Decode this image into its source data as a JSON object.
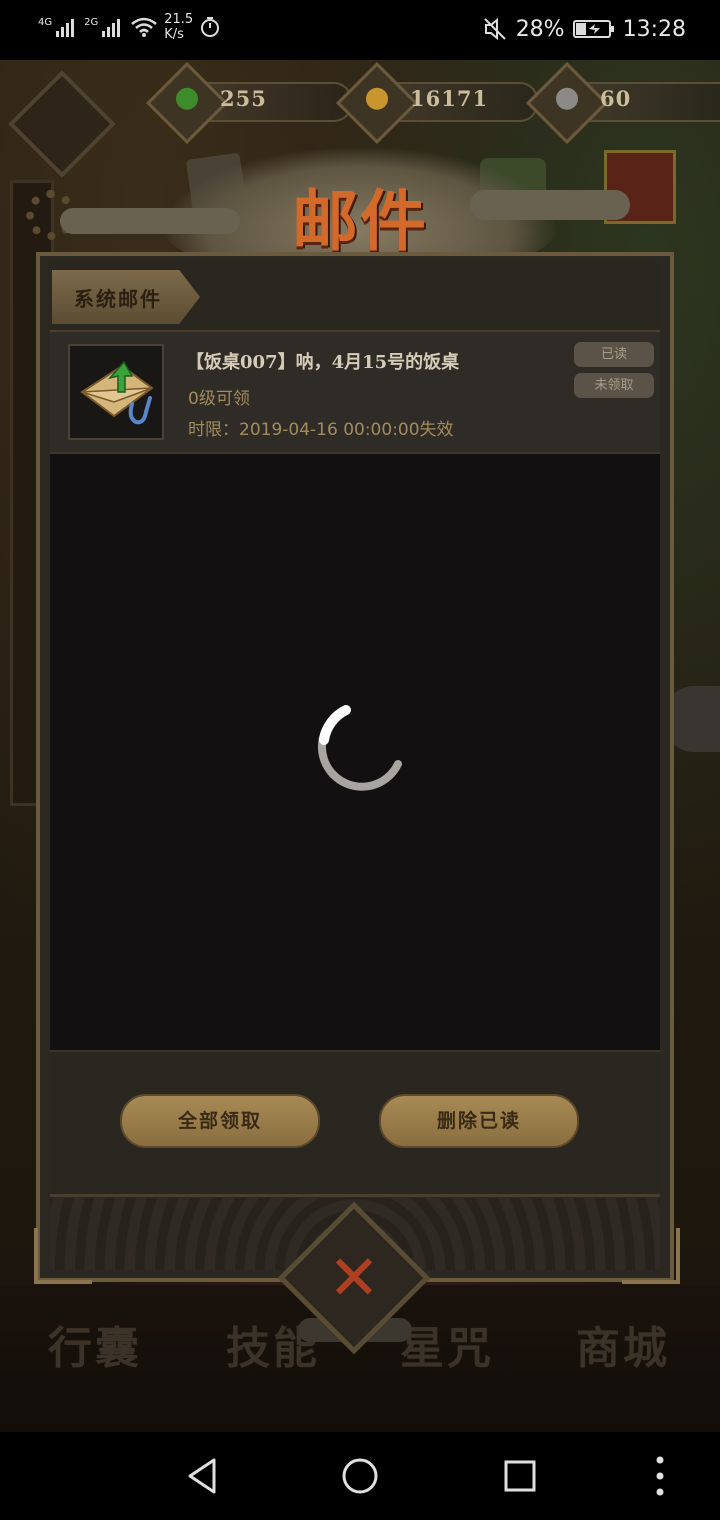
{
  "status_bar": {
    "network_1": "4G",
    "network_2": "2G",
    "speed_value": "21.5",
    "speed_unit": "K/s",
    "battery_percent": "28%",
    "time": "13:28"
  },
  "resources": [
    {
      "name": "jade",
      "icon": "green-flame-icon",
      "color": "#3d8b2a",
      "value": "255"
    },
    {
      "name": "coins",
      "icon": "gold-coin-icon",
      "color": "#c9952e",
      "value": "16171"
    },
    {
      "name": "spirit",
      "icon": "gray-swirl-icon",
      "color": "#8c8a86",
      "value": "60"
    }
  ],
  "dialog": {
    "title": "邮件",
    "tab_label": "系统邮件",
    "accent_color": "#d36a2a"
  },
  "mails": [
    {
      "title": "【饭桌007】呐，4月15号的饭桌",
      "level_requirement": "0级可领",
      "deadline": "时限：2019-04-16 00:00:00失效",
      "read_badge": "已读",
      "claim_badge": "未领取",
      "icon": "envelope-attachment-icon"
    }
  ],
  "footer": {
    "claim_all_label": "全部领取",
    "delete_read_label": "删除已读"
  },
  "background_nav": {
    "item_1": "行囊",
    "item_2": "技能",
    "item_3": "星咒",
    "item_4": "商城"
  }
}
